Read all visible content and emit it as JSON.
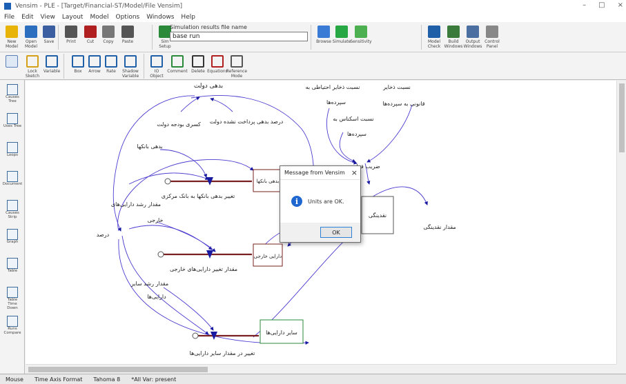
{
  "window": {
    "title": "Vensim - PLE - [Target/Financial-ST/Model/File Vensim]"
  },
  "menu": [
    "File",
    "Edit",
    "View",
    "Layout",
    "Model",
    "Options",
    "Windows",
    "Help"
  ],
  "toolbar_top": [
    {
      "label": "New Model",
      "icon": "new-model-icon",
      "color": "#e8b40a"
    },
    {
      "label": "Open Model",
      "icon": "open-model-icon",
      "color": "#2c6fbf"
    },
    {
      "label": "Save",
      "icon": "save-icon",
      "color": "#3b5fa0"
    },
    {
      "label": "Print",
      "icon": "print-icon",
      "color": "#555555"
    },
    {
      "label": "Cut",
      "icon": "cut-icon",
      "color": "#b02020"
    },
    {
      "label": "Copy",
      "icon": "copy-icon",
      "color": "#777777"
    },
    {
      "label": "Paste",
      "icon": "paste-icon",
      "color": "#555555"
    },
    {
      "label": "Sim Setup",
      "icon": "sim-setup-icon",
      "color": "#2a8a3a"
    },
    {
      "label": "Browse",
      "icon": "browse-icon",
      "color": "#3a7bd5"
    },
    {
      "label": "Simulate",
      "icon": "simulate-icon",
      "color": "#28a745"
    },
    {
      "label": "Sensitivity",
      "icon": "sensitivity-icon",
      "color": "#4caf50"
    },
    {
      "label": "Model Check",
      "icon": "model-check-icon",
      "color": "#1f5fa8"
    },
    {
      "label": "Build Windows",
      "icon": "build-windows-icon",
      "color": "#3a7a3a"
    },
    {
      "label": "Output Windows",
      "icon": "output-windows-icon",
      "color": "#4a6fa0"
    },
    {
      "label": "Control Panel",
      "icon": "control-panel-icon",
      "color": "#888888"
    }
  ],
  "simulation": {
    "label": "Simulation results file name",
    "value": "base run"
  },
  "toolbar_sketch": [
    {
      "label": "Lock Sketch",
      "icon": "lock-icon",
      "color": "#d4a017"
    },
    {
      "label": "Variable",
      "icon": "variable-icon",
      "color": "#1f5fa8"
    },
    {
      "label": "Box",
      "icon": "box-variable-icon",
      "color": "#1f5fa8"
    },
    {
      "label": "Arrow",
      "icon": "arrow-icon",
      "color": "#1f5fa8"
    },
    {
      "label": "Rate",
      "icon": "rate-icon",
      "color": "#1f5fa8"
    },
    {
      "label": "Shadow Variable",
      "icon": "shadow-variable-icon",
      "color": "#1f5fa8"
    },
    {
      "label": "IO Object",
      "icon": "io-object-icon",
      "color": "#1f5fa8"
    },
    {
      "label": "Comment",
      "icon": "comment-icon",
      "color": "#2a8a3a"
    },
    {
      "label": "Delete",
      "icon": "delete-icon",
      "color": "#333333"
    },
    {
      "label": "Equations",
      "icon": "equations-icon",
      "color": "#b02020"
    },
    {
      "label": "Reference Mode",
      "icon": "reference-mode-icon",
      "color": "#555555"
    }
  ],
  "sidebar": [
    {
      "label": "Causes Tree",
      "icon": "causes-tree-icon"
    },
    {
      "label": "Uses Tree",
      "icon": "uses-tree-icon"
    },
    {
      "label": "Loops",
      "icon": "loops-icon"
    },
    {
      "label": "Document",
      "icon": "document-icon"
    },
    {
      "label": "Causes Strip",
      "icon": "causes-strip-icon"
    },
    {
      "label": "Graph",
      "icon": "graph-icon"
    },
    {
      "label": "Table",
      "icon": "table-icon"
    },
    {
      "label": "Table Time Down",
      "icon": "table-down-icon"
    },
    {
      "label": "Runs Compare",
      "icon": "runs-compare-icon"
    }
  ],
  "diagram": {
    "labels": {
      "debt_to_govt": "بدهی دولت",
      "unpaid_debt_pct": "درصد بدهی پرداخت نشده دولت",
      "govt_budget_deficit": "کسری بودجه دولت",
      "bank_debt": "بدهی بانکها",
      "bank_debt_stock": "بدهی بانکها",
      "change_bank_debt_cb": "تغییر بدهی بانکها به بانک مرکزی",
      "foreign_asset_growth": "مقدار رشد دارایی‌های",
      "foreign": "خارجی",
      "percent": "درصد",
      "foreign_assets_stock": "دارایی خارجی",
      "change_foreign_assets": "مقدار تغییر دارایی‌های خارجی",
      "other_growth_1": "مقدار رشد سایر",
      "other_growth_2": "دارایی‌ها",
      "other_assets_stock": "سایر دارایی‌ها",
      "change_other_assets": "تغییر در مقدار سایر دارایی‌ها",
      "reserve_ratio_1": "نسبت ذخایر احتیاطی به",
      "reserve_ratio_2": "سپرده‌ها",
      "cash_ratio_1": "نسبت ذخایر",
      "cash_ratio_2": "قانونی به سپرده‌ها",
      "currency_ratio_1": "نسبت اسکناس به",
      "currency_ratio_2": "سپرده‌ها",
      "multiplier": "ضریب فزاینده",
      "liquidity_stock": "نقدینگی",
      "liquidity_amount": "مقدار نقدینگی"
    }
  },
  "dialog": {
    "title": "Message from Vensim",
    "message": "Units are OK.",
    "ok_label": "OK",
    "close": "×"
  },
  "status": [
    {
      "label": "Sketch",
      "value": "Mouse"
    },
    {
      "label": "Time Axis Format",
      "value": "Time Axis Format"
    },
    {
      "label": "Fonts",
      "value": "Tahoma 8"
    },
    {
      "label": "Var",
      "value": "*All Var: present"
    }
  ]
}
